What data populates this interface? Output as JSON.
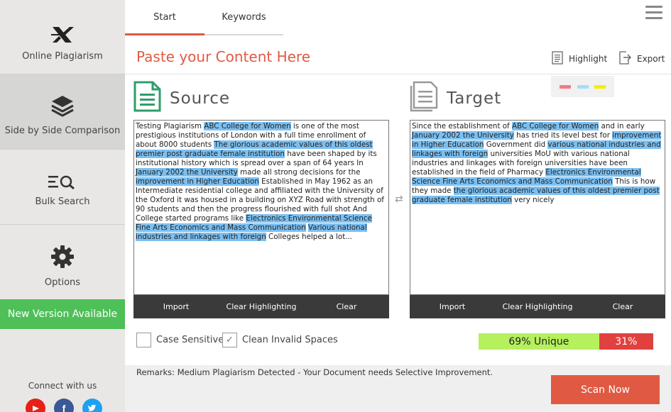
{
  "sidebar": {
    "items": [
      {
        "label": "Online Plagiarism",
        "icon": "x-logo-icon"
      },
      {
        "label": "Side by Side Comparison",
        "icon": "layers-icon"
      },
      {
        "label": "Bulk Search",
        "icon": "list-search-icon"
      },
      {
        "label": "Options",
        "icon": "gear-icon"
      }
    ],
    "new_version": "New Version Available",
    "connect": "Connect with us",
    "socials": [
      "youtube-icon",
      "facebook-icon",
      "twitter-icon"
    ]
  },
  "tabs": [
    "Start",
    "Keywords"
  ],
  "heading": "Paste your Content Here",
  "toolbar": {
    "highlight": "Highlight",
    "export": "Export"
  },
  "highlight_colors": [
    "#f07c8b",
    "#a8dcf4",
    "#f3f000"
  ],
  "source": {
    "title": "Source",
    "segments": [
      {
        "t": "Testing Plagiarism ",
        "h": false
      },
      {
        "t": "ABC College for Women",
        "h": true
      },
      {
        "t": " is one of the most prestigious institutions of London with a full time enrollment of about 8000 students ",
        "h": false
      },
      {
        "t": "The glorious academic values of this oldest premier post graduate female institution",
        "h": true
      },
      {
        "t": " have been shaped by its institutional history which is spread over a span of 64 years In ",
        "h": false
      },
      {
        "t": "January 2002 the University",
        "h": true
      },
      {
        "t": " made all strong decisions for the ",
        "h": false
      },
      {
        "t": "improvement in Higher Education",
        "h": true
      },
      {
        "t": " Established in May 1962 as an Intermediate residential college and affiliated with the University of the Oxford it was housed in a building on XYZ Road with strength of 90 students and then the progress flourished with full shot And College started programs like ",
        "h": false
      },
      {
        "t": "Electronics Environmental Science Fine Arts Economics and Mass Communication",
        "h": true
      },
      {
        "t": " ",
        "h": false
      },
      {
        "t": "Various national industries and linkages with foreign",
        "h": true
      },
      {
        "t": " Colleges helped a lot...",
        "h": false
      }
    ],
    "actions": [
      "Import",
      "Clear Highlighting",
      "Clear"
    ]
  },
  "target": {
    "title": "Target",
    "segments": [
      {
        "t": "Since the establishment of ",
        "h": false
      },
      {
        "t": "ABC College for Women",
        "h": true
      },
      {
        "t": " and in early ",
        "h": false
      },
      {
        "t": "January 2002 the University",
        "h": true
      },
      {
        "t": " has tried its level best for ",
        "h": false
      },
      {
        "t": "improvement in Higher Education",
        "h": true
      },
      {
        "t": " Government did ",
        "h": false
      },
      {
        "t": "various national industries and linkages with foreign",
        "h": true
      },
      {
        "t": " universities MoU with various national industries and linkages with foreign universities have been established in the field of Pharmacy ",
        "h": false
      },
      {
        "t": "Electronics Environmental Science Fine Arts Economics and Mass Communication",
        "h": true
      },
      {
        "t": " This is how they made ",
        "h": false
      },
      {
        "t": "the glorious academic values of this oldest premier post graduate female institution",
        "h": true
      },
      {
        "t": " very nicely",
        "h": false
      }
    ],
    "actions": [
      "Import",
      "Clear Highlighting",
      "Clear"
    ]
  },
  "options": {
    "case_sensitive": {
      "label": "Case Sensitive",
      "checked": false
    },
    "clean_spaces": {
      "label": "Clean Invalid Spaces",
      "checked": true
    }
  },
  "result": {
    "unique_label": "69% Unique",
    "plag_label": "31%",
    "unique_fraction": 0.69
  },
  "remarks": "Remarks: Medium Plagiarism Detected - Your Document needs Selective Improvement.",
  "scan_button": "Scan Now"
}
